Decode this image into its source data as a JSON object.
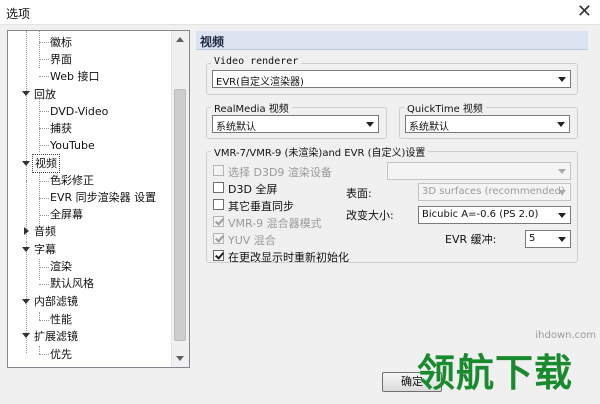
{
  "window": {
    "title": "选项",
    "close_icon": "close-icon"
  },
  "tree": {
    "items": [
      {
        "label": "徽标",
        "level": 1
      },
      {
        "label": "界面",
        "level": 1
      },
      {
        "label": "Web 接口",
        "level": 1
      },
      {
        "label": "回放",
        "level": 0,
        "expanded": true
      },
      {
        "label": "DVD-Video",
        "level": 1
      },
      {
        "label": "捕获",
        "level": 1
      },
      {
        "label": "YouTube",
        "level": 1
      },
      {
        "label": "视频",
        "level": 0,
        "expanded": true,
        "selected": true
      },
      {
        "label": "色彩修正",
        "level": 1
      },
      {
        "label": "EVR 同步渲染器 设置",
        "level": 1
      },
      {
        "label": "全屏幕",
        "level": 1
      },
      {
        "label": "音频",
        "level": 0,
        "expanded": false
      },
      {
        "label": "字幕",
        "level": 0,
        "expanded": true
      },
      {
        "label": "渲染",
        "level": 1
      },
      {
        "label": "默认风格",
        "level": 1
      },
      {
        "label": "内部滤镜",
        "level": 0,
        "expanded": true
      },
      {
        "label": "性能",
        "level": 1
      },
      {
        "label": "扩展滤镜",
        "level": 0,
        "expanded": true
      },
      {
        "label": "优先",
        "level": 1
      }
    ]
  },
  "panel": {
    "title": "视频",
    "video_renderer": {
      "legend": "Video renderer",
      "value": "EVR(自定义渲染器)"
    },
    "realmedia": {
      "legend": "RealMedia 视频",
      "value": "系统默认"
    },
    "quicktime": {
      "legend": "QuickTime 视频",
      "value": "系统默认"
    },
    "vmr": {
      "legend": "VMR-7/VMR-9 (未渲染)and EVR (自定义)设置",
      "select_d3d9": {
        "label": "选择 D3D9 渲染设备",
        "checked": false,
        "disabled": true
      },
      "d3d_fullscreen": {
        "label": "D3D 全屏",
        "checked": false
      },
      "vsync": {
        "label": "其它垂直同步",
        "checked": false
      },
      "vmr9_mixer": {
        "label": "VMR-9 混合器模式",
        "checked": true,
        "disabled": true
      },
      "yuv_mix": {
        "label": "YUV 混合",
        "checked": true,
        "disabled": true
      },
      "reinit": {
        "label": "在更改显示时重新初始化",
        "checked": true
      },
      "surface_label": "表面:",
      "surface_value": "3D surfaces (recommended)",
      "resize_label": "改变大小:",
      "resize_value": "Bicubic A=-0.6 (PS 2.0)",
      "evr_buffer_label": "EVR 缓冲:",
      "evr_buffer_value": "5"
    }
  },
  "footer": {
    "ok_label": "确定"
  },
  "watermark": {
    "site": "ihdown.com",
    "logo": "领航下载"
  }
}
